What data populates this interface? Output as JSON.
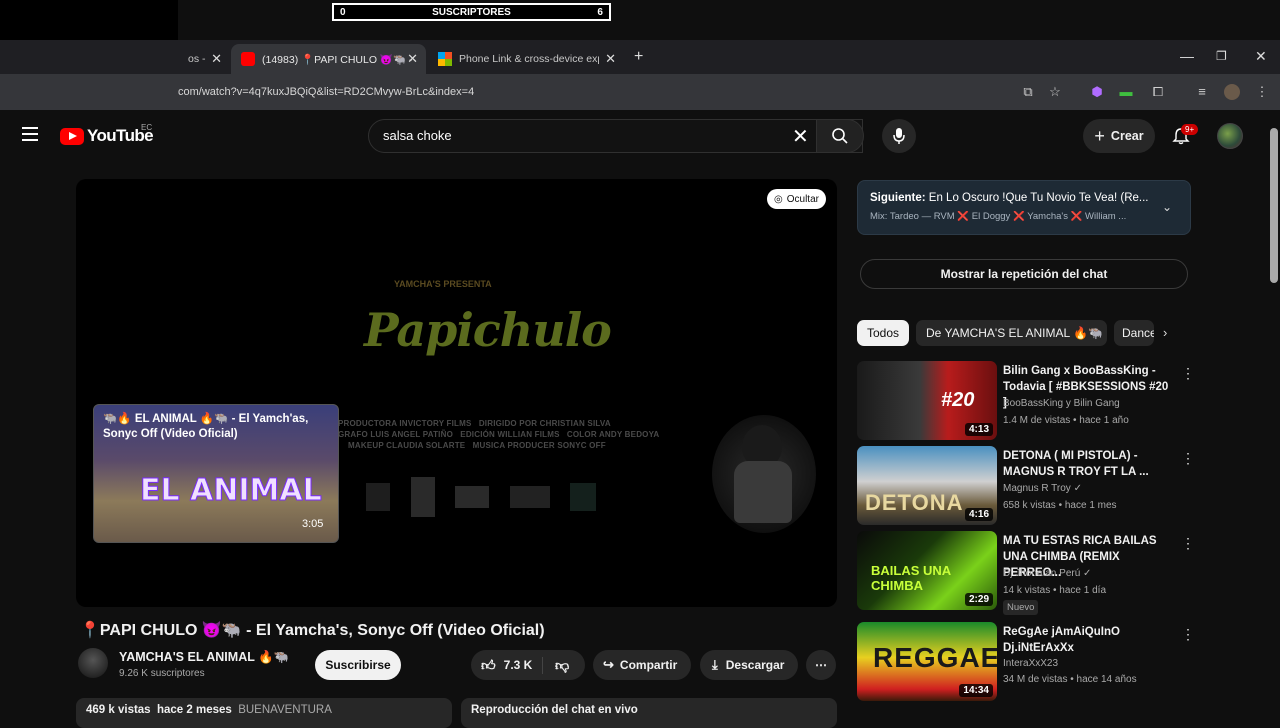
{
  "overlay": {
    "counter_left": "0",
    "counter_label": "SUSCRIPTORES",
    "counter_right": "6"
  },
  "browser": {
    "tabs": [
      {
        "label": "os -"
      },
      {
        "label": "(14983) 📍PAPI CHULO 😈🐃 -"
      },
      {
        "label": "Phone Link & cross-device expe"
      }
    ],
    "url": "com/watch?v=4q7kuxJBQiQ&list=RD2CMvyw-BrLc&index=4"
  },
  "youtube": {
    "logo_text": "YouTube",
    "region": "EC",
    "search_value": "salsa choke",
    "create_label": "Crear",
    "notif_count": "9+"
  },
  "player": {
    "hide_label": "Ocultar",
    "video_logo_title": "Papichulo",
    "presents": "YAMCHA'S PRESENTA",
    "credits": {
      "line1a": "PRODUCTORA",
      "line1b": "INVICTORY FILMS",
      "line1c": "DIRIGIDO POR",
      "line1d": "CHRISTIAN SILVA",
      "line2a": "GRAFO",
      "line2b": "LUIS ANGEL PATIÑO",
      "line2c": "EDICIÓN",
      "line2d": "WILLIAN FILMS",
      "line2e": "COLOR",
      "line2f": "ANDY BEDOYA",
      "line3a": "MAKEUP",
      "line3b": "CLAUDIA SOLARTE",
      "line3c": "MUSICA PRODUCER",
      "line3d": "SONYC OFF"
    },
    "endcard_title": "🐃🔥 EL ANIMAL 🔥🐃 - El Yamch'as, Sonyc Off (Video Oficial)",
    "endcard_art": "EL ANIMAL",
    "endcard_duration": "3:05"
  },
  "video": {
    "title": "📍PAPI CHULO 😈🐃 - El Yamcha's, Sonyc Off (Video Oficial)",
    "channel": "YAMCHA'S EL ANIMAL 🔥🐃",
    "subscribers": "9.26 K suscriptores",
    "subscribe_label": "Suscribirse",
    "likes": "7.3 K",
    "share_label": "Compartir",
    "download_label": "Descargar",
    "views": "469 k vistas",
    "date": "hace 2 meses",
    "location": "BUENAVENTURA",
    "chat_replay": "Reproducción del chat en vivo"
  },
  "sidebar": {
    "next_prefix": "Siguiente:",
    "next_title": "En Lo Oscuro !Que Tu Novio Te Vea! (Re...",
    "next_mix": "Mix: Tardeo — RVM ❌ El Doggy ❌ Yamcha's ❌ William ...",
    "chat_replay_btn": "Mostrar la repetición del chat",
    "chips": [
      "Todos",
      "De YAMCHA'S EL ANIMAL 🔥🐃",
      "Dance"
    ],
    "recs": [
      {
        "title": "Bilin Gang x BooBassKing - Todavia [ #BBKSESSIONS #20 ]",
        "channel": "BooBassKing y Bilin Gang",
        "meta": "1.4 M de vistas • hace 1 año",
        "duration": "4:13",
        "thumb_text": "#20"
      },
      {
        "title": "DETONA ( MI PISTOLA) - MAGNUS R TROY FT LA ...",
        "channel": "Magnus R Troy ✓",
        "meta": "658 k vistas • hace 1 mes",
        "duration": "4:16",
        "thumb_text": "DETONA"
      },
      {
        "title": "MA TU ESTAS RICA BAILAS UNA CHIMBA (REMIX PERREO...",
        "channel": "Dj Jhonatan Perú ✓",
        "meta": "14 k vistas • hace 1 día",
        "duration": "2:29",
        "badge": "Nuevo",
        "thumb_text": "BAILAS UNA CHIMBA"
      },
      {
        "title": "ReGgAe jAmAiQuInO Dj.iNtErAxXx",
        "channel": "InteraXxX23",
        "meta": "34 M de vistas • hace 14 años",
        "duration": "14:34",
        "thumb_text": "REGGAE"
      }
    ]
  },
  "colors": {
    "accent": "#ff0000",
    "background": "#0f0f0f",
    "chrome": "#35363a"
  }
}
